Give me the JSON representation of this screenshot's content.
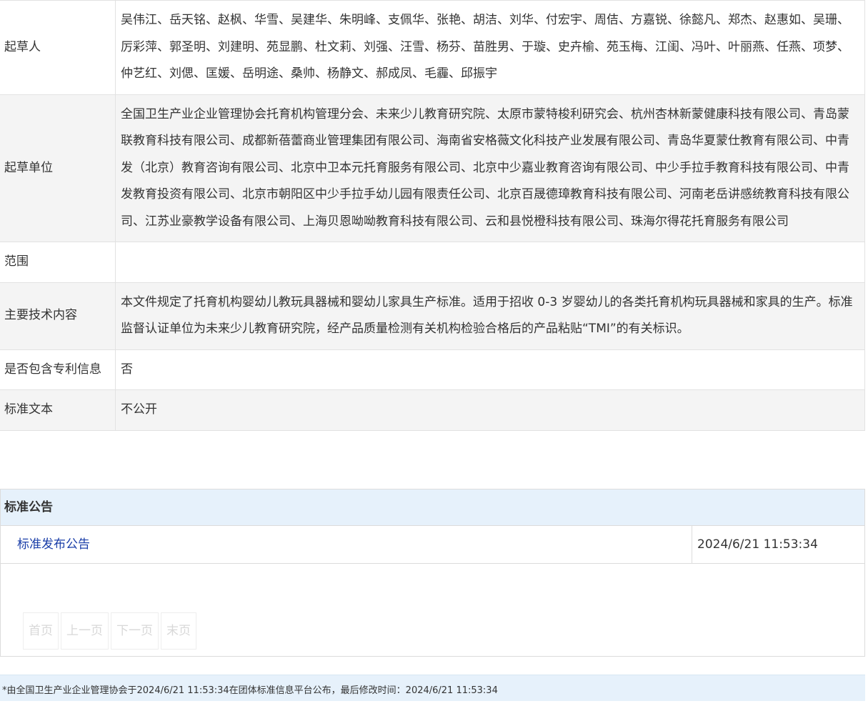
{
  "details": {
    "drafters_label": "起草人",
    "drafters_value": "吴伟江、岳天铭、赵枫、华雪、吴建华、朱明峰、支佩华、张艳、胡洁、刘华、付宏宇、周佶、方嘉锐、徐懿凡、郑杰、赵惠如、吴珊、厉彩萍、郭圣明、刘建明、苑显鹏、杜文莉、刘强、汪雪、杨芬、苗胜男、于璇、史卉榆、苑玉梅、江闺、冯叶、叶丽燕、任燕、项梦、仲艺红、刘偲、匡媛、岳明途、桑帅、杨静文、郝成凤、毛霾、邱振宇",
    "units_label": "起草单位",
    "units_value": "全国卫生产业企业管理协会托育机构管理分会、未来少儿教育研究院、太原市蒙特梭利研究会、杭州杏林新蒙健康科技有限公司、青岛蒙联教育科技有限公司、成都新蓓蕾商业管理集团有限公司、海南省安格薇文化科技产业发展有限公司、青岛华夏蒙仕教育有限公司、中青发（北京）教育咨询有限公司、北京中卫本元托育服务有限公司、北京中少嘉业教育咨询有限公司、中少手拉手教育科技有限公司、中青发教育投资有限公司、北京市朝阳区中少手拉手幼儿园有限责任公司、北京百晟德璋教育科技有限公司、河南老岳讲感统教育科技有限公司、江苏业豪教学设备有限公司、上海贝恩呦呦教育科技有限公司、云和县悦橙科技有限公司、珠海尔得花托育服务有限公司",
    "scope_label": "范围",
    "scope_value": "",
    "tech_label": "主要技术内容",
    "tech_value": "本文件规定了托育机构婴幼儿教玩具器械和婴幼儿家具生产标准。适用于招收 0-3 岁婴幼儿的各类托育机构玩具器械和家具的生产。标准监督认证单位为未来少儿教育研究院，经产品质量检测有关机构检验合格后的产品粘贴“TMI”的有关标识。",
    "patent_label": "是否包含专利信息",
    "patent_value": "否",
    "text_label": "标准文本",
    "text_value": "不公开"
  },
  "notices": {
    "header": "标准公告",
    "items": [
      {
        "title": "标准发布公告",
        "date": "2024/6/21 11:53:34"
      }
    ]
  },
  "pager": {
    "first": "首页",
    "prev": "上一页",
    "next": "下一页",
    "last": "末页"
  },
  "footer": {
    "text": "*由全国卫生产业企业管理协会于2024/6/21 11:53:34在团体标准信息平台公布，最后修改时间：2024/6/21 11:53:34"
  },
  "colors": {
    "link": "#1a3ea8",
    "header_bg": "#e6f1fb",
    "row_shade": "#f4f4f4"
  }
}
